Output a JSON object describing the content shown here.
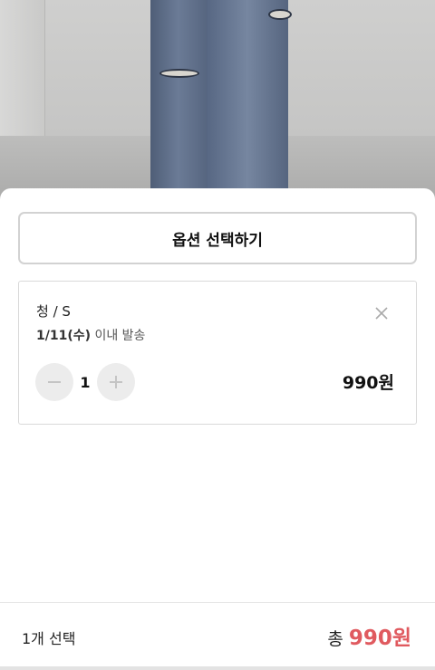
{
  "sheet": {
    "option_button_label": "옵션 선택하기"
  },
  "item": {
    "name": "청 / S",
    "ship_date": "1/11(수)",
    "ship_suffix": " 이내 발송",
    "quantity": "1",
    "price": "990원"
  },
  "footer": {
    "selected_count": "1개 선택",
    "total_label": "총",
    "total_amount": "990원"
  },
  "colors": {
    "accent": "#e05a5f",
    "border": "#d9d9d9",
    "stepper_bg": "#ececec"
  },
  "icons": {
    "close": "close-icon",
    "minus": "minus-icon",
    "plus": "plus-icon"
  }
}
